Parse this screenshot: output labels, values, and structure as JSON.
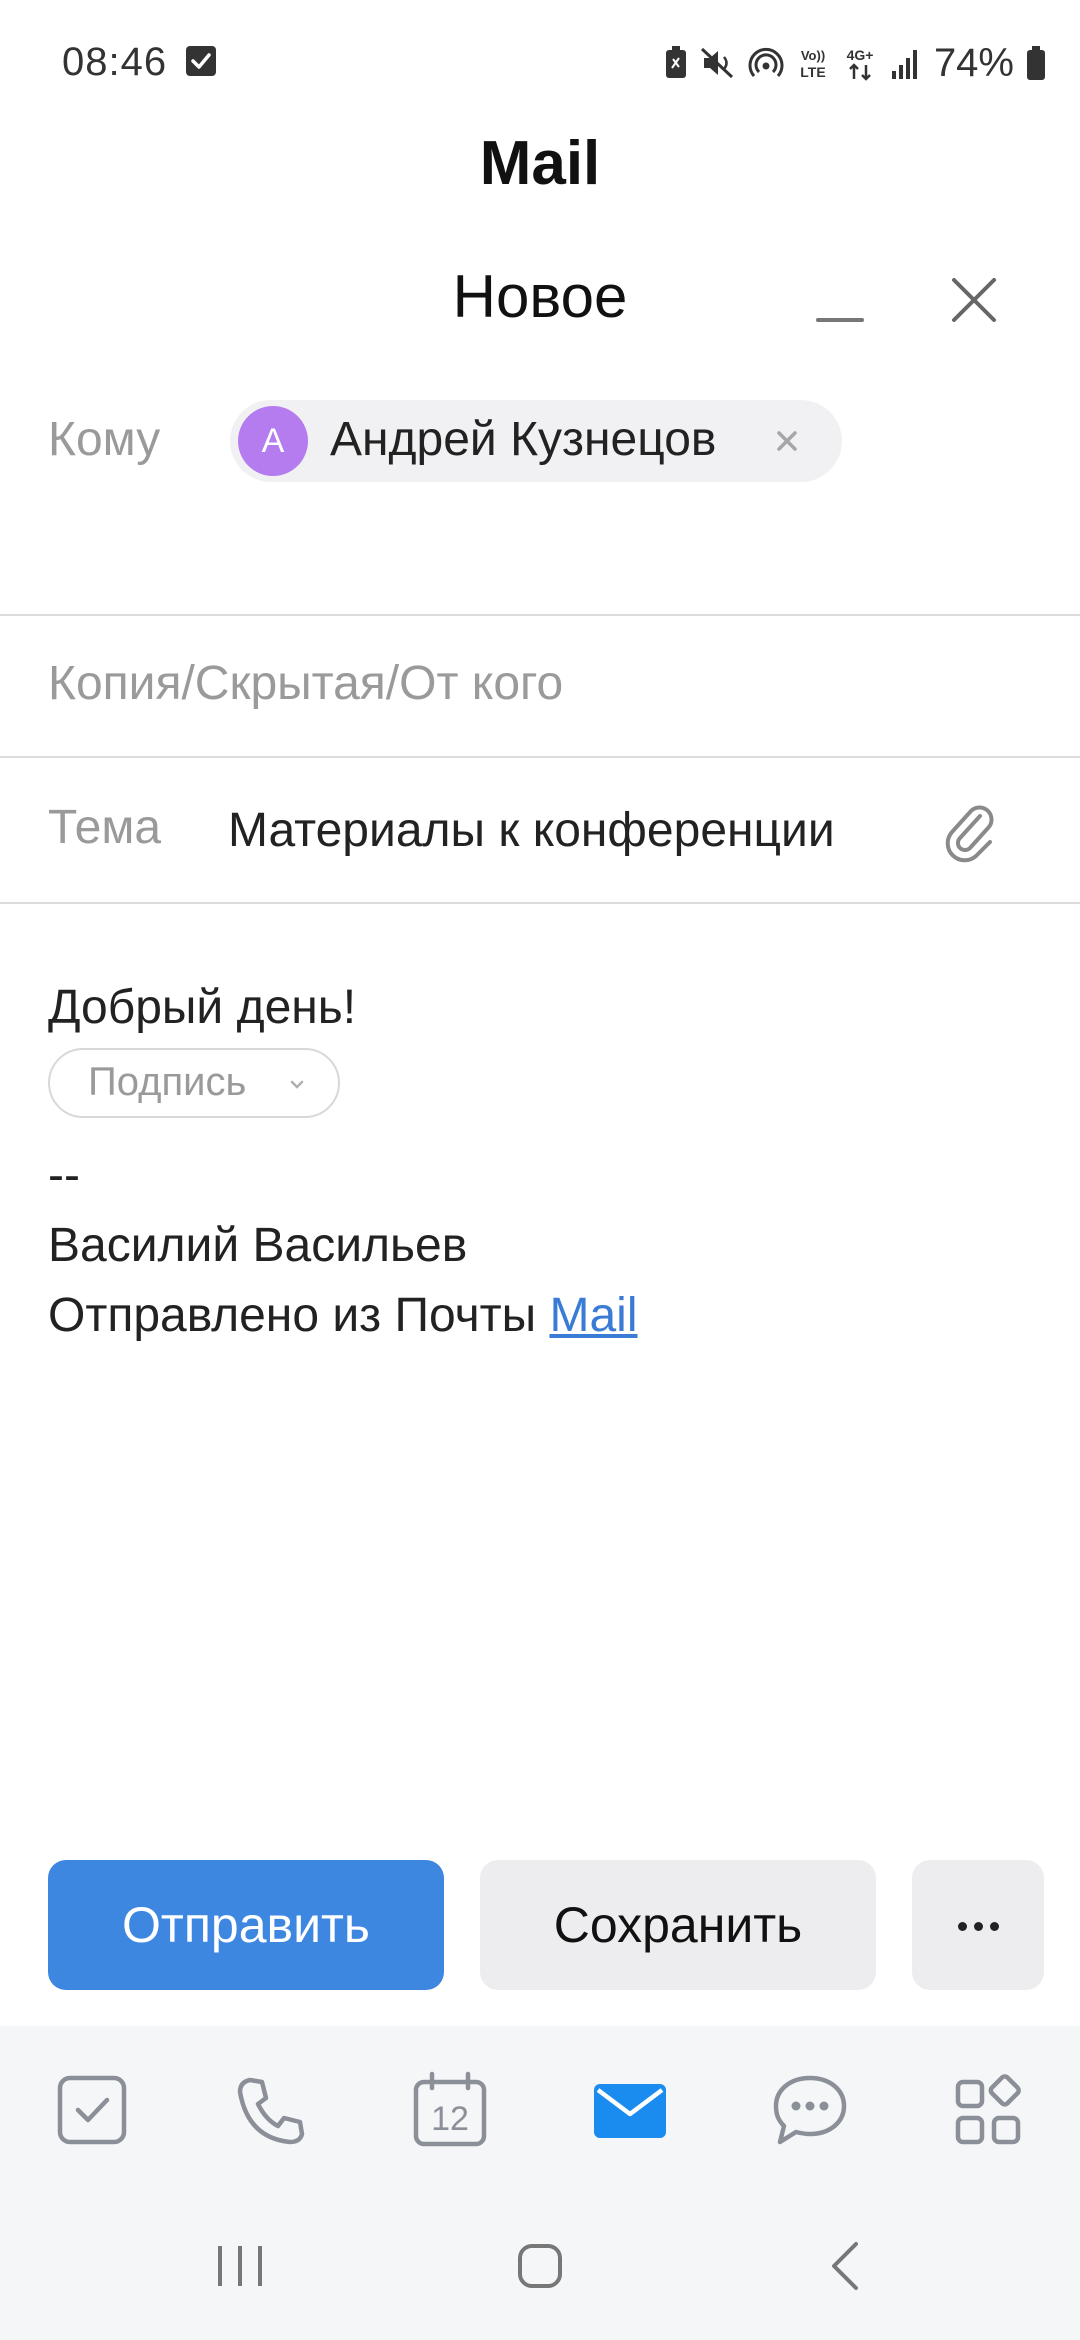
{
  "status_bar": {
    "time": "08:46",
    "battery_text": "74%",
    "icons": [
      "notification-check-icon",
      "battery-saver-icon",
      "mute-icon",
      "hotspot-icon",
      "volte-icon",
      "4g-icon",
      "signal-icon",
      "battery-icon"
    ],
    "volte_label_top": "Vo))",
    "volte_label_bottom": "LTE",
    "network_label": "4G+"
  },
  "app": {
    "title": "Mail"
  },
  "compose": {
    "title": "Новое",
    "to": {
      "label": "Кому",
      "recipient": {
        "initial": "А",
        "name": "Андрей Кузнецов",
        "avatar_color": "#b57cf0"
      }
    },
    "cc_label": "Копия/Скрытая/От кого",
    "subject": {
      "label": "Тема",
      "value": "Материалы к конференции"
    },
    "body": {
      "greeting": "Добрый день!",
      "signature_button": "Подпись",
      "sig_dash": "--",
      "sig_name": "Василий Васильев",
      "sent_from": "Отправлено из Почты ",
      "sent_from_link": "Mail"
    }
  },
  "actions": {
    "send": "Отправить",
    "save": "Сохранить"
  },
  "bottom_nav": {
    "items": [
      {
        "name": "tasks",
        "icon": "tasks-icon"
      },
      {
        "name": "calls",
        "icon": "phone-icon"
      },
      {
        "name": "calendar",
        "icon": "calendar-icon",
        "label": "12"
      },
      {
        "name": "mail",
        "icon": "mail-icon",
        "active": true
      },
      {
        "name": "messenger",
        "icon": "chat-icon"
      },
      {
        "name": "apps",
        "icon": "apps-icon"
      }
    ],
    "active_color": "#1a8cf0",
    "inactive_color": "#8a8f98"
  },
  "colors": {
    "accent": "#3e87e0",
    "link": "#3a7bd5"
  }
}
